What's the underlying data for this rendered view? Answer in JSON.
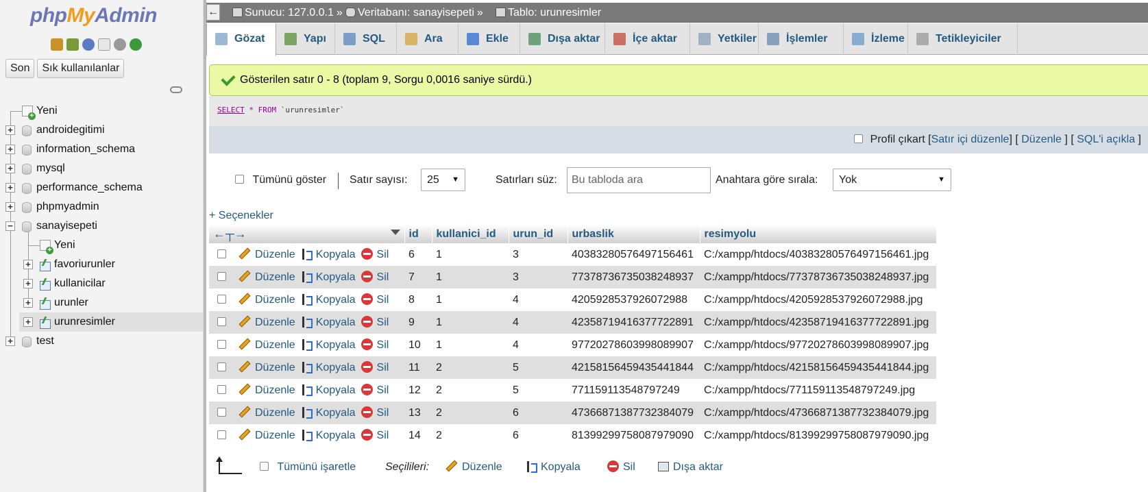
{
  "nav": {
    "logo": {
      "php": "php",
      "my": "My",
      "admin": "Admin"
    },
    "buttons": {
      "recent": "Son",
      "favorites": "Sık kullanılanlar"
    },
    "tree": [
      {
        "label": "Yeni",
        "kind": "new",
        "level": 0
      },
      {
        "label": "androidegitimi",
        "kind": "db",
        "level": 0
      },
      {
        "label": "information_schema",
        "kind": "db",
        "level": 0
      },
      {
        "label": "mysql",
        "kind": "db",
        "level": 0
      },
      {
        "label": "performance_schema",
        "kind": "db",
        "level": 0
      },
      {
        "label": "phpmyadmin",
        "kind": "db",
        "level": 0
      },
      {
        "label": "sanayisepeti",
        "kind": "db-open",
        "level": 0
      },
      {
        "label": "Yeni",
        "kind": "new",
        "level": 1
      },
      {
        "label": "favoriurunler",
        "kind": "table",
        "level": 1
      },
      {
        "label": "kullanicilar",
        "kind": "table",
        "level": 1
      },
      {
        "label": "urunler",
        "kind": "table",
        "level": 1
      },
      {
        "label": "urunresimler",
        "kind": "table",
        "level": 1,
        "selected": true
      },
      {
        "label": "test",
        "kind": "db",
        "level": 0
      }
    ]
  },
  "breadcrumb": {
    "server": "Sunucu: 127.0.0.1",
    "database": "Veritabanı: sanayisepeti",
    "table": "Tablo: urunresimler",
    "sep": "»"
  },
  "tabs": [
    {
      "label": "Gözat",
      "active": true,
      "icon": "browse-icon",
      "color": "#7aa0c8"
    },
    {
      "label": "Yapı",
      "icon": "structure-icon",
      "color": "#5a8c3a"
    },
    {
      "label": "SQL",
      "icon": "sql-icon",
      "color": "#5b87c0"
    },
    {
      "label": "Ara",
      "icon": "search-icon",
      "color": "#d9a440"
    },
    {
      "label": "Ekle",
      "icon": "insert-icon",
      "color": "#2b6bd1"
    },
    {
      "label": "Dışa aktar",
      "icon": "export-icon",
      "color": "#4a8a5a"
    },
    {
      "label": "İçe aktar",
      "icon": "import-icon",
      "color": "#c44a3a"
    },
    {
      "label": "Yetkiler",
      "icon": "privileges-icon",
      "color": "#8aa0b8"
    },
    {
      "label": "İşlemler",
      "icon": "wrench-icon",
      "color": "#6a8ab0"
    },
    {
      "label": "İzleme",
      "icon": "eye-icon",
      "color": "#6a9ac8"
    },
    {
      "label": "Tetikleyiciler",
      "icon": "triggers-icon",
      "color": "#9a9a9a"
    }
  ],
  "success": {
    "text": "Gösterilen satır 0 - 8 (toplam 9, Sorgu 0,0016 saniye sürdü.)"
  },
  "sql": {
    "select": "SELECT",
    "star": "*",
    "from": "FROM",
    "table": "`urunresimler`"
  },
  "profile": {
    "label": "Profil çıkart",
    "inline_edit": "Satır içi düzenle",
    "edit": "Düzenle",
    "explain": "SQL'i açıkla",
    "lb": "[",
    "rb": "]"
  },
  "controls": {
    "show_all": "Tümünü göster",
    "row_count_label": "Satır sayısı:",
    "row_count_value": "25",
    "filter_label": "Satırları süz:",
    "filter_placeholder": "Bu tabloda ara",
    "sort_label": "Anahtara göre sırala:",
    "sort_value": "Yok"
  },
  "options_link": "+ Seçenekler",
  "table": {
    "columns": [
      "id",
      "kullanici_id",
      "urun_id",
      "urbaslik",
      "resimyolu"
    ],
    "actions": {
      "edit": "Düzenle",
      "copy": "Kopyala",
      "delete": "Sil"
    },
    "rows": [
      [
        "6",
        "1",
        "3",
        "40383280576497156461",
        "C:/xampp/htdocs/40383280576497156461.jpg"
      ],
      [
        "7",
        "1",
        "3",
        "77378736735038248937",
        "C:/xampp/htdocs/77378736735038248937.jpg"
      ],
      [
        "8",
        "1",
        "4",
        "4205928537926072988",
        "C:/xampp/htdocs/4205928537926072988.jpg"
      ],
      [
        "9",
        "1",
        "4",
        "42358719416377722891",
        "C:/xampp/htdocs/42358719416377722891.jpg"
      ],
      [
        "10",
        "1",
        "4",
        "97720278603998089907",
        "C:/xampp/htdocs/97720278603998089907.jpg"
      ],
      [
        "11",
        "2",
        "5",
        "42158156459435441844",
        "C:/xampp/htdocs/42158156459435441844.jpg"
      ],
      [
        "12",
        "2",
        "5",
        "771159113548797249",
        "C:/xampp/htdocs/771159113548797249.jpg"
      ],
      [
        "13",
        "2",
        "6",
        "47366871387732384079",
        "C:/xampp/htdocs/47366871387732384079.jpg"
      ],
      [
        "14",
        "2",
        "6",
        "81399299758087979090",
        "C:/xampp/htdocs/81399299758087979090.jpg"
      ]
    ]
  },
  "bulk": {
    "check_all": "Tümünü işaretle",
    "with_selected": "Seçilileri:",
    "edit": "Düzenle",
    "copy": "Kopyala",
    "delete": "Sil",
    "export": "Dışa aktar"
  },
  "colors": {
    "link": "#235a81",
    "success_bg": "#ebf8a4",
    "row_alt": "#dfdfdf"
  }
}
